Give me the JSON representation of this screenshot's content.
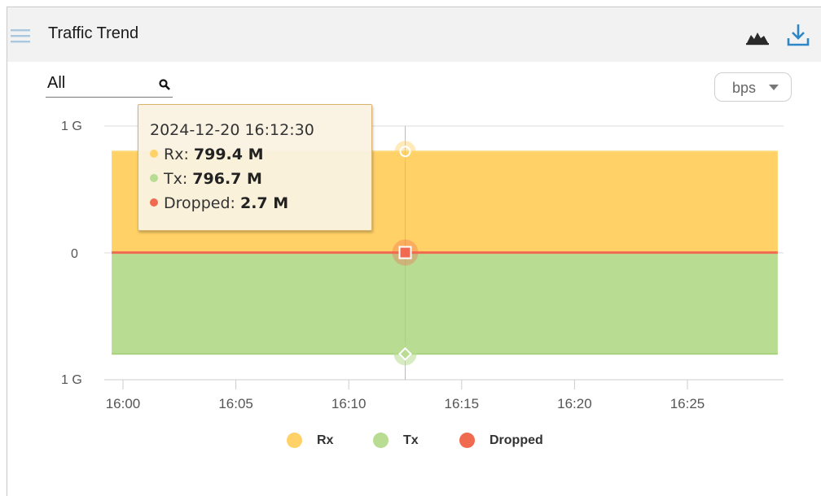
{
  "panel": {
    "title": "Traffic Trend",
    "icons": [
      "menu-icon",
      "area-chart-icon",
      "download-icon"
    ]
  },
  "filter": {
    "value": "All",
    "icon": "search-icon"
  },
  "unit_select": {
    "value": "bps"
  },
  "tooltip": {
    "time": "2024-12-20 16:12:30",
    "rows": [
      {
        "label": "Rx: ",
        "value": "799.4 M",
        "color": "#ffd166"
      },
      {
        "label": "Tx: ",
        "value": "796.7 M",
        "color": "#b8dc92"
      },
      {
        "label": "Dropped: ",
        "value": "2.7 M",
        "color": "#f06a50"
      }
    ]
  },
  "chart_data": {
    "type": "area",
    "x": [
      "16:00",
      "16:05",
      "16:10",
      "16:15",
      "16:20",
      "16:25"
    ],
    "x_range": [
      "15:59:30",
      "16:29:00"
    ],
    "y_ticks": [
      "1 G",
      "0",
      "1 G"
    ],
    "ylim": [
      -1000,
      1000
    ],
    "y_unit": "Mbps",
    "grid": true,
    "legend_placement": "bottom-center",
    "series": [
      {
        "name": "Rx",
        "color": "#ffd166",
        "direction": "up",
        "values_mbps": [
          799.4,
          799.4
        ]
      },
      {
        "name": "Tx",
        "color": "#b8dc92",
        "direction": "down",
        "values_mbps": [
          796.7,
          796.7
        ]
      },
      {
        "name": "Dropped",
        "color": "#f06a50",
        "direction": "up",
        "values_mbps": [
          2.7,
          2.7
        ]
      }
    ],
    "highlight_time": "16:12:30"
  }
}
